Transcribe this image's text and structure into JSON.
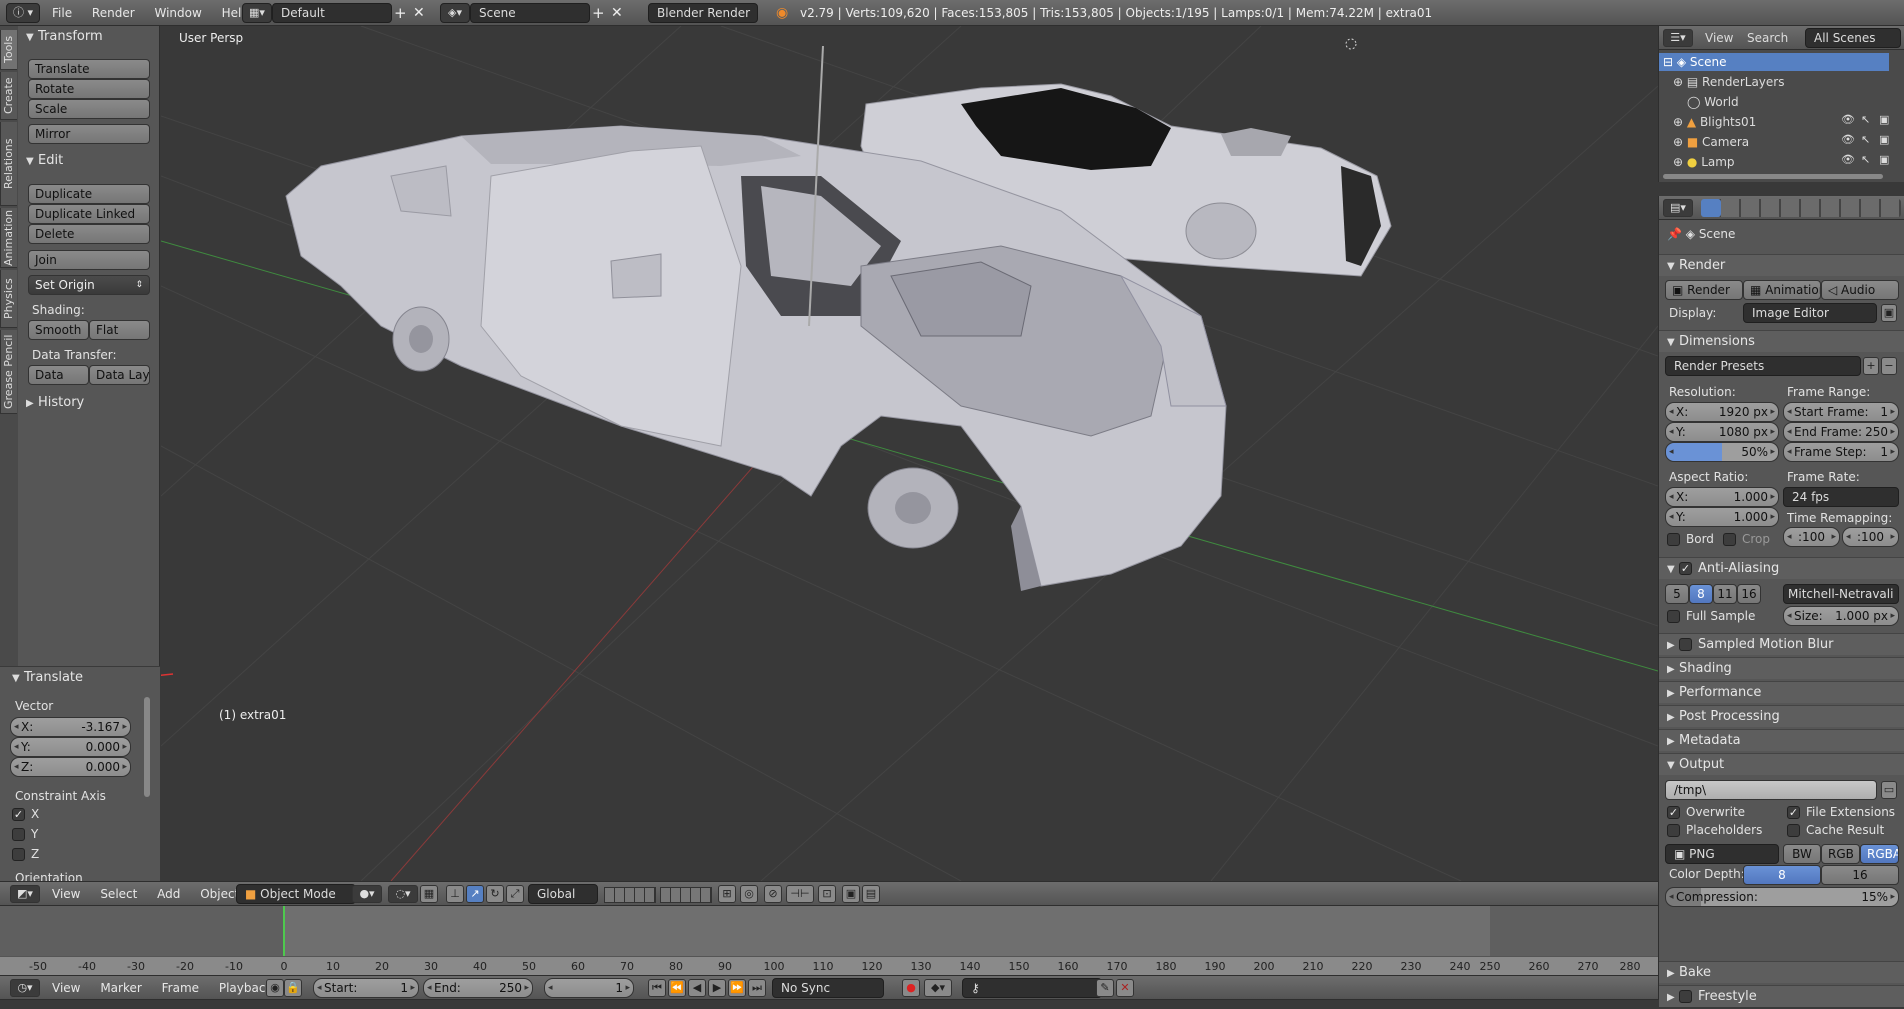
{
  "topbar": {
    "menus": [
      "File",
      "Render",
      "Window",
      "Help"
    ],
    "layout": "Default",
    "scene": "Scene",
    "engine": "Blender Render",
    "stats": "v2.79 | Verts:109,620 | Faces:153,805 | Tris:153,805 | Objects:1/195 | Lamps:0/1 | Mem:74.22M | extra01"
  },
  "tool_tabs": [
    "Tools",
    "Create",
    "Relations",
    "Animation",
    "Physics",
    "Grease Pencil"
  ],
  "tools": {
    "transform_title": "Transform",
    "translate": "Translate",
    "rotate": "Rotate",
    "scale": "Scale",
    "mirror": "Mirror",
    "edit_title": "Edit",
    "duplicate": "Duplicate",
    "duplicate_linked": "Duplicate Linked",
    "delete": "Delete",
    "join": "Join",
    "set_origin": "Set Origin",
    "shading_label": "Shading:",
    "smooth": "Smooth",
    "flat": "Flat",
    "data_transfer_label": "Data Transfer:",
    "data": "Data",
    "data_layo": "Data Layo",
    "history_title": "History"
  },
  "operator": {
    "title": "Translate",
    "vector_label": "Vector",
    "x_label": "X:",
    "x": "-3.167",
    "y_label": "Y:",
    "y": "0.000",
    "z_label": "Z:",
    "z": "0.000",
    "constraint_label": "Constraint Axis",
    "cx": "X",
    "cy": "Y",
    "cz": "Z",
    "orientation_label": "Orientation"
  },
  "viewport": {
    "view_name": "User Persp",
    "object_label": "(1) extra01"
  },
  "view3d_header": {
    "view": "View",
    "select": "Select",
    "add": "Add",
    "object": "Object",
    "mode": "Object Mode",
    "orientation": "Global"
  },
  "timeline": {
    "ticks": [
      "-50",
      "-40",
      "-30",
      "-20",
      "-10",
      "0",
      "10",
      "20",
      "30",
      "40",
      "50",
      "60",
      "70",
      "80",
      "90",
      "100",
      "110",
      "120",
      "130",
      "140",
      "150",
      "160",
      "170",
      "180",
      "190",
      "200",
      "210",
      "220",
      "230",
      "240",
      "250",
      "260",
      "270",
      "280"
    ],
    "view": "View",
    "marker": "Marker",
    "frame": "Frame",
    "playback": "Playback",
    "start_label": "Start:",
    "start": "1",
    "end_label": "End:",
    "end": "250",
    "current": "1",
    "sync": "No Sync"
  },
  "outliner": {
    "view": "View",
    "search": "Search",
    "filter": "All Scenes",
    "items": [
      "Scene",
      "RenderLayers",
      "World",
      "Blights01",
      "Camera",
      "Lamp"
    ]
  },
  "properties": {
    "context": "Scene",
    "render_title": "Render",
    "render_btn": "Render",
    "animation_btn": "Animation",
    "audio_btn": "Audio",
    "display_label": "Display:",
    "display": "Image Editor",
    "dimensions_title": "Dimensions",
    "render_presets": "Render Presets",
    "resolution_label": "Resolution:",
    "res_x_label": "X:",
    "res_x": "1920 px",
    "res_y_label": "Y:",
    "res_y": "1080 px",
    "res_pct": "50%",
    "frame_range_label": "Frame Range:",
    "start_frame_label": "Start Frame:",
    "start_frame": "1",
    "end_frame_label": "End Frame:",
    "end_frame": "250",
    "frame_step_label": "Frame Step:",
    "frame_step": "1",
    "aspect_label": "Aspect Ratio:",
    "asp_x_label": "X:",
    "asp_x": "1.000",
    "asp_y_label": "Y:",
    "asp_y": "1.000",
    "frame_rate_label": "Frame Rate:",
    "frame_rate": "24 fps",
    "time_remap_label": "Time Remapping:",
    "remap_old": ":100",
    "remap_new": ":100",
    "bord": "Bord",
    "crop": "Crop",
    "aa_title": "Anti-Aliasing",
    "aa_samples": [
      "5",
      "8",
      "11",
      "16"
    ],
    "aa_filter": "Mitchell-Netravali",
    "full_sample": "Full Sample",
    "size_label": "Size:",
    "size": "1.000 px",
    "sampled_mb": "Sampled Motion Blur",
    "shading": "Shading",
    "performance": "Performance",
    "post_processing": "Post Processing",
    "metadata": "Metadata",
    "output_title": "Output",
    "output_path": "/tmp\\",
    "overwrite": "Overwrite",
    "file_extensions": "File Extensions",
    "placeholders": "Placeholders",
    "cache_result": "Cache Result",
    "format": "PNG",
    "bw": "BW",
    "rgb": "RGB",
    "rgba": "RGBA",
    "color_depth_label": "Color Depth:",
    "depth_8": "8",
    "depth_16": "16",
    "compression_label": "Compression:",
    "compression": "15%",
    "bake": "Bake",
    "freestyle": "Freestyle"
  },
  "colors": {
    "accent": "#5680c2",
    "grid": "#404040",
    "x_axis": "#8b3a3a",
    "y_axis": "#3f8b3f",
    "frame_cursor": "#4ec94e"
  }
}
